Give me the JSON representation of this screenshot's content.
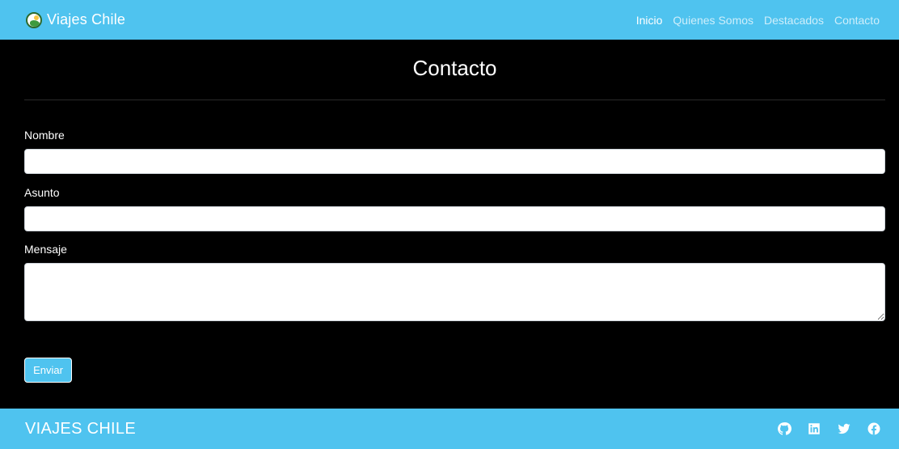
{
  "navbar": {
    "brand": "Viajes Chile",
    "links": [
      {
        "label": "Inicio",
        "active": true
      },
      {
        "label": "Quienes Somos",
        "active": false
      },
      {
        "label": "Destacados",
        "active": false
      },
      {
        "label": "Contacto",
        "active": false
      }
    ]
  },
  "main": {
    "title": "Contacto",
    "form": {
      "nombre_label": "Nombre",
      "nombre_value": "",
      "asunto_label": "Asunto",
      "asunto_value": "",
      "mensaje_label": "Mensaje",
      "mensaje_value": "",
      "submit_label": "Enviar"
    }
  },
  "footer": {
    "title": "VIAJES CHILE",
    "social_icons": [
      "github-icon",
      "linkedin-icon",
      "twitter-icon",
      "facebook-icon"
    ]
  },
  "colors": {
    "accent": "#4fc3ef",
    "background": "#000000",
    "text": "#ffffff"
  }
}
